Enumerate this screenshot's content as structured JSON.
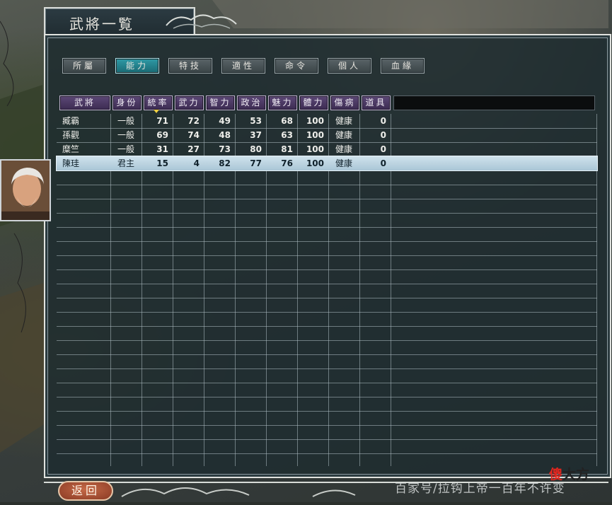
{
  "window": {
    "title": "武將一覧"
  },
  "tabs": [
    {
      "label": "所屬",
      "active": false
    },
    {
      "label": "能力",
      "active": true
    },
    {
      "label": "特技",
      "active": false
    },
    {
      "label": "適性",
      "active": false
    },
    {
      "label": "命令",
      "active": false
    },
    {
      "label": "個人",
      "active": false
    },
    {
      "label": "血緣",
      "active": false
    }
  ],
  "table": {
    "columns": [
      "武將",
      "身份",
      "統率",
      "武力",
      "智力",
      "政治",
      "魅力",
      "體力",
      "傷病",
      "道具"
    ],
    "sorted_column": "統率",
    "rows": [
      {
        "name": "臧霸",
        "rank": "一般",
        "lead": "71",
        "war": "72",
        "int": "49",
        "pol": "53",
        "cha": "68",
        "hp": "100",
        "health": "健康",
        "items": "0"
      },
      {
        "name": "孫觀",
        "rank": "一般",
        "lead": "69",
        "war": "74",
        "int": "48",
        "pol": "37",
        "cha": "63",
        "hp": "100",
        "health": "健康",
        "items": "0"
      },
      {
        "name": "糜竺",
        "rank": "一般",
        "lead": "31",
        "war": "27",
        "int": "73",
        "pol": "80",
        "cha": "81",
        "hp": "100",
        "health": "健康",
        "items": "0"
      },
      {
        "name": "陳珪",
        "rank": "君主",
        "lead": "15",
        "war": "4",
        "int": "82",
        "pol": "77",
        "cha": "76",
        "hp": "100",
        "health": "健康",
        "items": "0"
      }
    ],
    "selected_row": 3
  },
  "footer": {
    "back_label": "返回",
    "watermark": "百家号/拉钩上帝一百年不许变",
    "brand_part1": "傻",
    "brand_part2": "大方"
  },
  "colors": {
    "panel": "#1f2c30",
    "header_purple": "#5c4876",
    "active_tab": "#2f9aa6",
    "selected_row": "#cfe2ec"
  }
}
